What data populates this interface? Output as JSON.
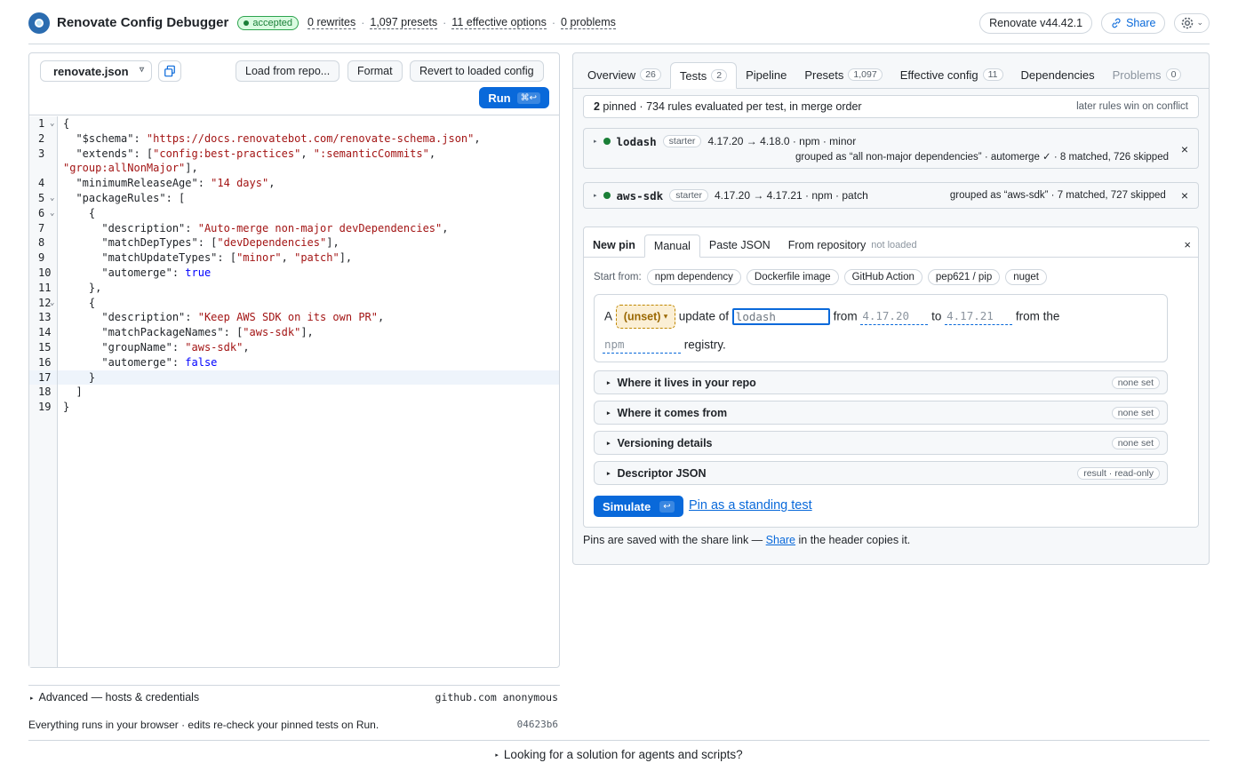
{
  "header": {
    "title": "Renovate Config Debugger",
    "status": "accepted",
    "stats": [
      "0 rewrites",
      "1,097 presets",
      "11 effective options",
      "0 problems"
    ],
    "version_label": "Renovate v44.42.1",
    "share_label": "Share"
  },
  "editor": {
    "file": "renovate.json",
    "buttons": {
      "load": "Load from repo...",
      "format": "Format",
      "revert": "Revert to loaded config"
    },
    "run_label": "Run",
    "run_kbd": "⌘↩",
    "active_line": 17,
    "lines": [
      {
        "n": "1",
        "fold": true,
        "html": "{"
      },
      {
        "n": "2",
        "fold": false,
        "html": "  \"$schema\": <span class=\"s\">\"https://docs.renovatebot.com/renovate-schema.json\"</span>,"
      },
      {
        "n": "3",
        "fold": false,
        "html": "  \"extends\": [<span class=\"s\">\"config:best-practices\"</span>, <span class=\"s\">\":semanticCommits\"</span>,"
      },
      {
        "n": "",
        "fold": false,
        "html": "<span class=\"s\">\"group:allNonMajor\"</span>],"
      },
      {
        "n": "4",
        "fold": false,
        "html": "  \"minimumReleaseAge\": <span class=\"s\">\"14 days\"</span>,"
      },
      {
        "n": "5",
        "fold": true,
        "html": "  \"packageRules\": ["
      },
      {
        "n": "6",
        "fold": true,
        "html": "    {"
      },
      {
        "n": "7",
        "fold": false,
        "html": "      \"description\": <span class=\"s\">\"Auto-merge non-major devDependencies\"</span>,"
      },
      {
        "n": "8",
        "fold": false,
        "html": "      \"matchDepTypes\": [<span class=\"s\">\"devDependencies\"</span>],"
      },
      {
        "n": "9",
        "fold": false,
        "html": "      \"matchUpdateTypes\": [<span class=\"s\">\"minor\"</span>, <span class=\"s\">\"patch\"</span>],"
      },
      {
        "n": "10",
        "fold": false,
        "html": "      \"automerge\": <span class=\"b\">true</span>"
      },
      {
        "n": "11",
        "fold": false,
        "html": "    },"
      },
      {
        "n": "12",
        "fold": true,
        "html": "    {"
      },
      {
        "n": "13",
        "fold": false,
        "html": "      \"description\": <span class=\"s\">\"Keep AWS SDK on its own PR\"</span>,"
      },
      {
        "n": "14",
        "fold": false,
        "html": "      \"matchPackageNames\": [<span class=\"s\">\"aws-sdk\"</span>],"
      },
      {
        "n": "15",
        "fold": false,
        "html": "      \"groupName\": <span class=\"s\">\"aws-sdk\"</span>,"
      },
      {
        "n": "16",
        "fold": false,
        "html": "      \"automerge\": <span class=\"b\">false</span>"
      },
      {
        "n": "17",
        "fold": false,
        "html": "    }"
      },
      {
        "n": "18",
        "fold": false,
        "html": "  ]"
      },
      {
        "n": "19",
        "fold": false,
        "html": "}"
      }
    ]
  },
  "advanced": {
    "label": "Advanced — hosts & credentials",
    "right": "github.com anonymous"
  },
  "footer": {
    "info": "Everything runs in your browser · edits re-check your pinned tests on Run.",
    "hash": "04623b6",
    "agents": "Looking for a solution for agents and scripts?"
  },
  "tabs": [
    {
      "label": "Overview",
      "count": "26",
      "active": false,
      "disabled": false
    },
    {
      "label": "Tests",
      "count": "2",
      "active": true,
      "disabled": false
    },
    {
      "label": "Pipeline",
      "count": "",
      "active": false,
      "disabled": false
    },
    {
      "label": "Presets",
      "count": "1,097",
      "active": false,
      "disabled": false
    },
    {
      "label": "Effective config",
      "count": "11",
      "active": false,
      "disabled": false
    },
    {
      "label": "Dependencies",
      "count": "",
      "active": false,
      "disabled": false
    },
    {
      "label": "Problems",
      "count": "0",
      "active": false,
      "disabled": true
    }
  ],
  "summary": {
    "count": "2",
    "text": " pinned · 734 rules evaluated per test, in merge order",
    "right": "later rules win on conflict"
  },
  "pins": [
    {
      "name": "lodash",
      "badge": "starter",
      "info": "4.17.20 → 4.18.0 · npm · minor",
      "result": "grouped as “all non-major dependencies” · automerge ✓ · 8 matched, 726 skipped"
    },
    {
      "name": "aws-sdk",
      "badge": "starter",
      "info": "4.17.20 → 4.17.21 · npm · patch",
      "result": "grouped as “aws-sdk” · 7 matched, 727 skipped"
    }
  ],
  "newpin": {
    "title": "New pin",
    "tabs": [
      "Manual",
      "Paste JSON",
      "From repository"
    ],
    "not_loaded": "not loaded",
    "start_label": "Start from:",
    "chips": [
      "npm dependency",
      "Dockerfile image",
      "GitHub Action",
      "pep621 / pip",
      "nuget"
    ],
    "sentence": {
      "a": "A",
      "unset": "(unset)",
      "update_of": "update of",
      "pkg": "lodash",
      "from": "from",
      "from_v": "4.17.20",
      "to": "to",
      "to_v": "4.17.21",
      "from_the": "from the",
      "registry_v": "npm",
      "registry": "registry."
    },
    "sections": [
      {
        "label": "Where it lives in your repo",
        "tag": "none set"
      },
      {
        "label": "Where it comes from",
        "tag": "none set"
      },
      {
        "label": "Versioning details",
        "tag": "none set"
      },
      {
        "label": "Descriptor JSON",
        "tag": "result · read-only"
      }
    ],
    "simulate": "Simulate",
    "simulate_kbd": "↩",
    "pin_link": "Pin as a standing test"
  },
  "share_note": {
    "pre": "Pins are saved with the share link — ",
    "link": "Share",
    "post": " in the header copies it."
  }
}
